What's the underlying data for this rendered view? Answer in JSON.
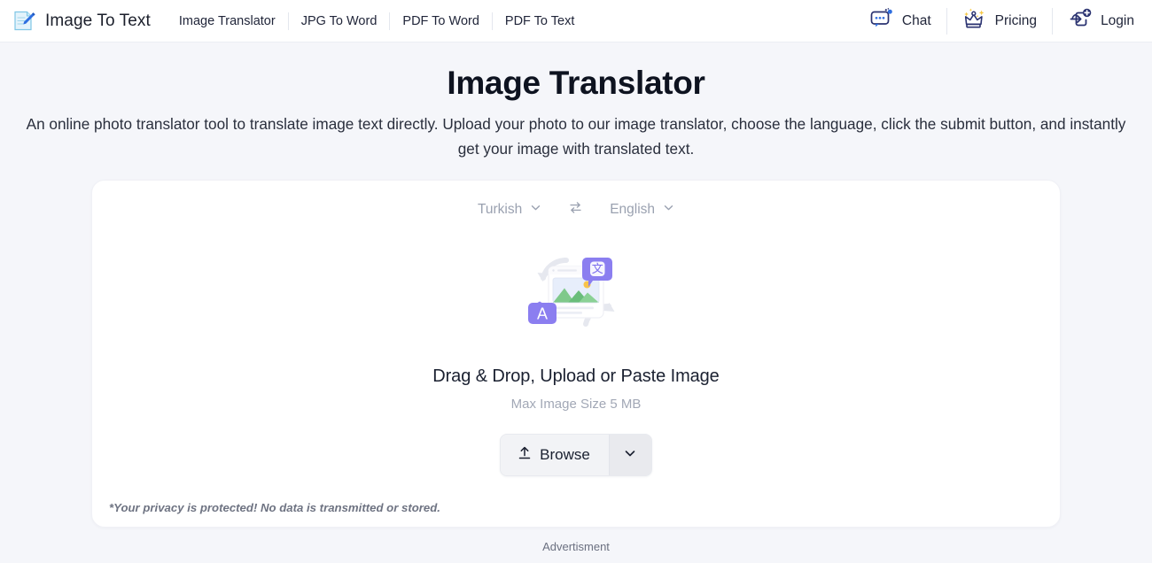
{
  "header": {
    "brand": {
      "label": "Image To Text",
      "icon": "document-pen-icon"
    },
    "nav": [
      {
        "label": "Image Translator",
        "name": "nav-image-translator"
      },
      {
        "label": "JPG To Word",
        "name": "nav-jpg-to-word"
      },
      {
        "label": "PDF To Word",
        "name": "nav-pdf-to-word"
      },
      {
        "label": "PDF To Text",
        "name": "nav-pdf-to-text"
      }
    ],
    "actions": [
      {
        "label": "Chat",
        "icon": "chat-bubble-icon"
      },
      {
        "label": "Pricing",
        "icon": "crown-icon"
      },
      {
        "label": "Login",
        "icon": "login-arrow-icon"
      }
    ]
  },
  "hero": {
    "title": "Image Translator",
    "description": "An online photo translator tool to translate image text directly. Upload your photo to our image translator, choose the language, click the submit button, and instantly get your image with translated text."
  },
  "tool": {
    "source_language": "Turkish",
    "target_language": "English",
    "swap_icon": "swap-arrows-icon",
    "dropzone_title": "Drag & Drop, Upload or Paste Image",
    "dropzone_subtitle": "Max Image Size 5 MB",
    "browse_label": "Browse",
    "browse_icon": "upload-icon",
    "browse_caret_icon": "chevron-down-icon",
    "privacy_note": "*Your privacy is protected! No data is transmitted or stored."
  },
  "footer": {
    "ad_label": "Advertisment"
  },
  "colors": {
    "page_bg": "#f5f6fa",
    "card_bg": "#ffffff",
    "accent_purple": "#8b7ef0",
    "accent_blue": "#2f6fe0",
    "brand_navy": "#2a3270",
    "muted_text": "#9aa1b0"
  }
}
